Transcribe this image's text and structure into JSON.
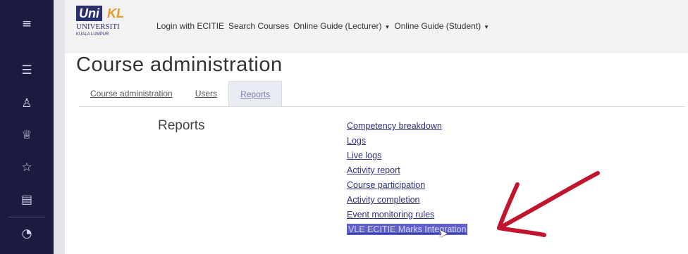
{
  "sidebar": {
    "items": [
      {
        "icon": "menu-icon",
        "glyph": "≡"
      },
      {
        "icon": "list-icon",
        "glyph": "☰"
      },
      {
        "icon": "users-icon",
        "glyph": "♙"
      },
      {
        "icon": "badge-icon",
        "glyph": "♕"
      },
      {
        "icon": "star-icon",
        "glyph": "☆"
      },
      {
        "icon": "book-icon",
        "glyph": "▤"
      },
      {
        "icon": "dashboard-icon",
        "glyph": "◔"
      }
    ]
  },
  "logo": {
    "uni": "Uni",
    "kl": "KL",
    "line1": "UNIVERSITI",
    "line2": "KUALA LUMPUR"
  },
  "navbar": {
    "login_ecitie": "Login with ECITIE",
    "search_courses": "Search Courses",
    "guide_lecturer": "Online Guide (Lecturer)",
    "guide_student": "Online Guide (Student)"
  },
  "page_title": "Course administration",
  "tabs": [
    {
      "label": "Course administration"
    },
    {
      "label": "Users"
    },
    {
      "label": "Reports"
    }
  ],
  "reports": {
    "heading": "Reports",
    "items": [
      "Competency breakdown",
      "Logs",
      "Live logs",
      "Activity report",
      "Course participation",
      "Activity completion",
      "Event monitoring rules",
      "VLE ECITIE Marks Integration"
    ]
  },
  "colors": {
    "sidebar": "#1a1b3f",
    "highlight": "#5f60c8",
    "arrow": "#c0152c",
    "link": "#2d3180"
  }
}
